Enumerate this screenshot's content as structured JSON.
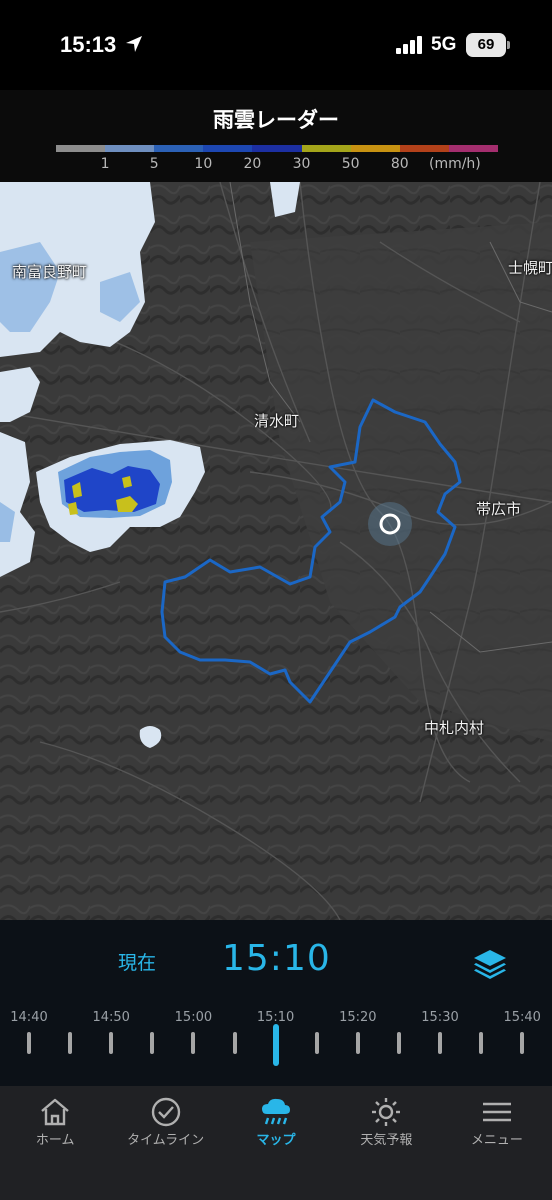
{
  "status_bar": {
    "time": "15:13",
    "network": "5G",
    "battery": "69"
  },
  "header": {
    "title": "雨雲レーダー",
    "legend": {
      "colors": [
        "#8d8d8d",
        "#6f8fbf",
        "#2c61b6",
        "#1d47b2",
        "#1c2fa2",
        "#a4a51a",
        "#c79212",
        "#b3411a",
        "#a42e6e"
      ],
      "labels": [
        "1",
        "5",
        "10",
        "20",
        "30",
        "50",
        "80",
        "(mm/h)"
      ]
    }
  },
  "map": {
    "places": {
      "minamifurano": "南富良野町",
      "shimizu": "清水町",
      "obihiro": "帯広市",
      "nakasatsunai": "中札内村",
      "shihoro": "士幌町"
    },
    "colors": {
      "terrain": "#3b3b3b",
      "boundary": "#1b67c5",
      "rain_light": "#d9e5f2",
      "rain_medium": "#6ea2dc",
      "rain_heavy": "#1f45c8",
      "rain_strong": "#c8c01c"
    }
  },
  "timeline": {
    "now_label": "現在",
    "current_time": "15:10",
    "ticks": [
      "14:40",
      "14:50",
      "15:00",
      "15:10",
      "15:20",
      "15:30",
      "15:40"
    ],
    "active_tick": "15:10",
    "accent": "#29b6e8"
  },
  "nav": {
    "home": "ホーム",
    "timeline": "タイムライン",
    "map": "マップ",
    "forecast": "天気予報",
    "menu": "メニュー"
  }
}
